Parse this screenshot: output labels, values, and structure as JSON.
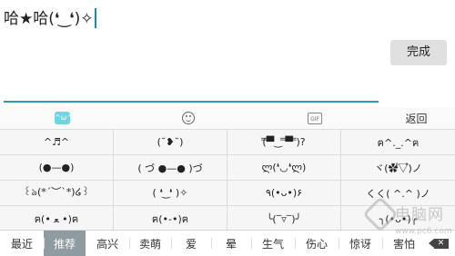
{
  "compose": {
    "text": "哈★哈(❛ ͜ ❛)✧",
    "done_label": "完成"
  },
  "tabs": {
    "kaomoji_icon_text": "^ω^",
    "gif_icon_text": "GIF",
    "back_label": "返回"
  },
  "kaomoji_rows": [
    [
      "^♬^",
      "(˘❥˘)",
      "(̿▀̿‿ ̿▀̿ ̿)?",
      "ฅ^._.^ฅ"
    ],
    [
      "(●—●)",
      "( づ ●—● )づ",
      "ლ(❛◡❛ლ)",
      "ヾ(✿゚▽゚)ノ"
    ],
    [
      "꒰ঌ(*´︶`*)໒꒱",
      "( ❛ ͜ ❛ )✧",
      "٩(•ᴗ•)۶",
      "くく( ^.^ )ノ"
    ],
    [
      "ฅ(• ﻌ •)ฅ",
      "ฅ(•-•)ฅ",
      "╰(‾▿‾)╯",
      "╮(•ᴗ•)╭"
    ]
  ],
  "bottom_categories": [
    "最近",
    "推荐",
    "高兴",
    "卖萌",
    "爱",
    "晕",
    "生气",
    "伤心",
    "惊讶",
    "害怕"
  ],
  "active_category": "推荐",
  "delete_icon_glyph": "✕",
  "watermark": {
    "brand": "电脑网",
    "sub": "www.pc6.com"
  }
}
